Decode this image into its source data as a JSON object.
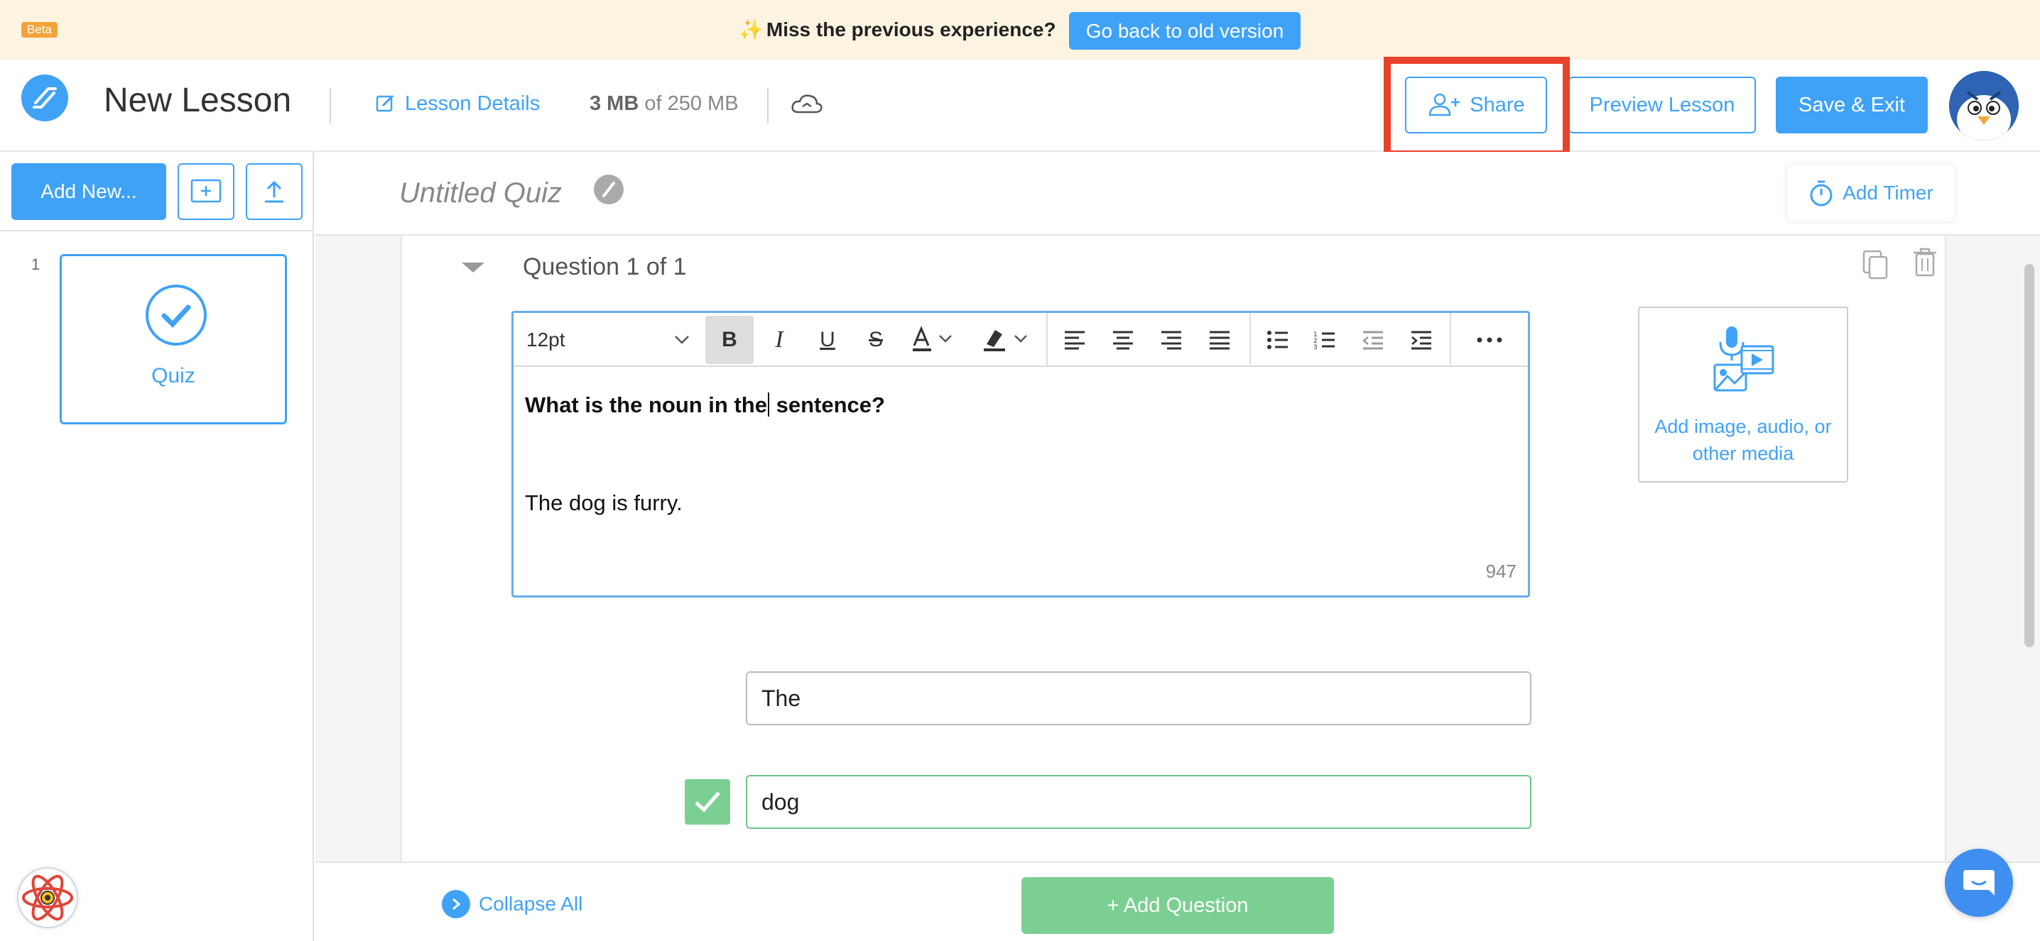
{
  "banner": {
    "beta_label": "Beta",
    "spark": "✨",
    "message": "Miss the previous experience?",
    "old_version_button": "Go back to old version"
  },
  "header": {
    "lesson_title": "New Lesson",
    "lesson_details": "Lesson Details",
    "storage_used": "3 MB",
    "storage_rest": " of 250 MB",
    "share_button": "Share",
    "preview_button": "Preview Lesson",
    "save_button": "Save & Exit"
  },
  "sidebar": {
    "add_new_button": "Add New...",
    "slides": [
      {
        "number": "1",
        "label": "Quiz"
      }
    ]
  },
  "quiz": {
    "title": "Untitled Quiz",
    "add_timer_button": "Add Timer",
    "question_label": "Question 1 of 1",
    "editor": {
      "font_size": "12pt",
      "text_line1_a": "What is the noun in the",
      "text_line1_b": " sentence?",
      "text_line2": "The dog is furry.",
      "char_count": "947"
    },
    "media_label": "Add image, audio, or other media",
    "answers": [
      {
        "text": "The",
        "correct": false
      },
      {
        "text": "dog",
        "correct": true
      }
    ]
  },
  "footer": {
    "collapse_all": "Collapse All",
    "add_question_button": "+ Add Question"
  },
  "colors": {
    "primary": "#3fa2f7",
    "success": "#7ccf92",
    "highlight": "#e8412c",
    "banner_bg": "#fdf3e1"
  },
  "icons": [
    "logo-icon",
    "edit-icon",
    "cloud-icon",
    "share-user-icon",
    "avatar",
    "add-slide-icon",
    "upload-icon",
    "checkmark-icon",
    "pencil-icon",
    "timer-icon",
    "copy-icon",
    "trash-icon",
    "microphone-media-icon",
    "check-icon",
    "chevron-right-icon",
    "react-logo-icon",
    "chat-icon"
  ]
}
